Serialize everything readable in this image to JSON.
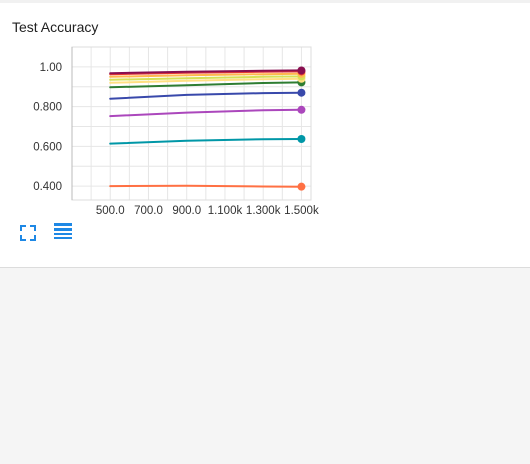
{
  "card": {
    "title": "Test Accuracy"
  },
  "icons": {
    "expand": "fullscreen-icon",
    "data_toggle": "list-icon",
    "color": "#1e88e5"
  },
  "chart_data": {
    "type": "line",
    "title": "Test Accuracy",
    "xlabel": "",
    "ylabel": "",
    "xlim": [
      300,
      1550
    ],
    "ylim": [
      0.33,
      1.1
    ],
    "grid": true,
    "legend": "none",
    "x_ticks": [
      500,
      700,
      900,
      1100,
      1300,
      1500
    ],
    "x_tick_labels": [
      "500.0",
      "700.0",
      "900.0",
      "1.100k",
      "1.300k",
      "1.500k"
    ],
    "y_ticks": [
      0.4,
      0.6,
      0.8,
      1.0
    ],
    "y_tick_labels": [
      "0.400",
      "0.600",
      "0.800",
      "1.00"
    ],
    "x": [
      500,
      900,
      1300,
      1500
    ],
    "series": [
      {
        "color": "#ff7043",
        "values": [
          0.4,
          0.402,
          0.398,
          0.397
        ]
      },
      {
        "color": "#0097a7",
        "values": [
          0.614,
          0.628,
          0.636,
          0.637
        ]
      },
      {
        "color": "#ab47bc",
        "values": [
          0.752,
          0.77,
          0.782,
          0.784
        ]
      },
      {
        "color": "#3949ab",
        "values": [
          0.84,
          0.859,
          0.868,
          0.87
        ]
      },
      {
        "color": "#2e7d32",
        "values": [
          0.897,
          0.908,
          0.919,
          0.922
        ]
      },
      {
        "color": "#ffe082",
        "values": [
          0.92,
          0.93,
          0.938,
          0.94
        ]
      },
      {
        "color": "#d4e157",
        "values": [
          0.935,
          0.943,
          0.95,
          0.952
        ]
      },
      {
        "color": "#ffb74d",
        "values": [
          0.95,
          0.958,
          0.963,
          0.965
        ]
      },
      {
        "color": "#e53935",
        "values": [
          0.963,
          0.97,
          0.975,
          0.977
        ]
      },
      {
        "color": "#880e4f",
        "values": [
          0.968,
          0.975,
          0.98,
          0.982
        ]
      }
    ]
  }
}
